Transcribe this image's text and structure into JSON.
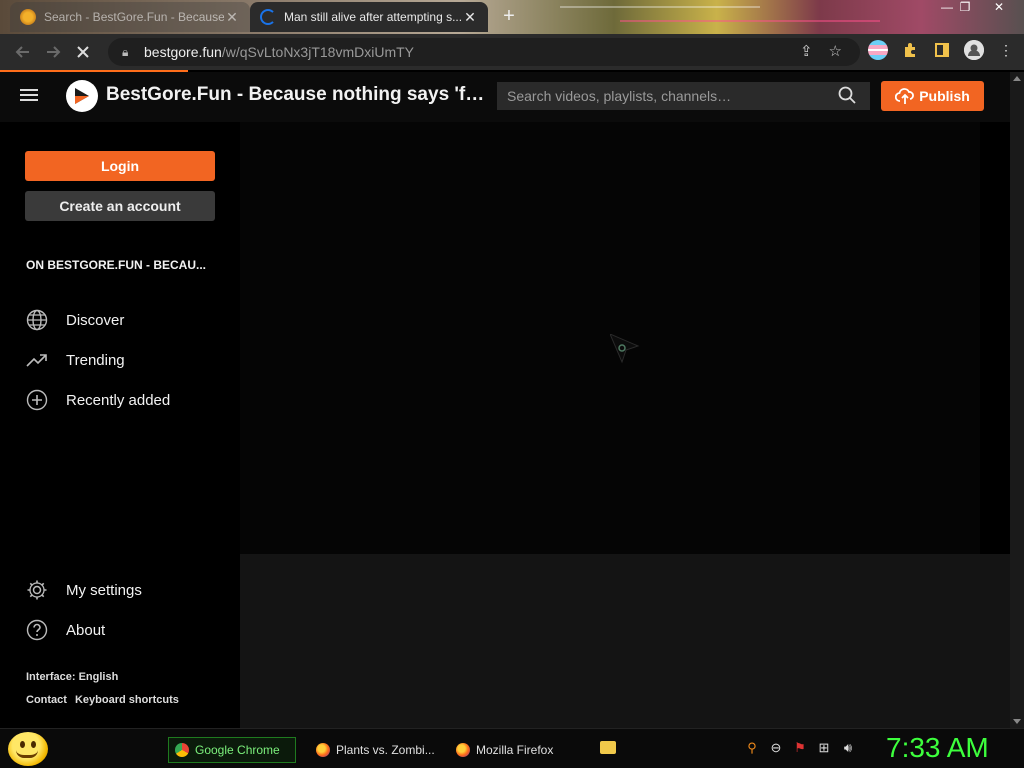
{
  "browser": {
    "tabs": [
      {
        "title": "Search - BestGore.Fun - Because...",
        "active": false
      },
      {
        "title": "Man still alive after attempting s...",
        "active": true
      }
    ],
    "new_tab_label": "+",
    "window_controls": {
      "minimize": "—",
      "maximize": "❐",
      "close": "✕"
    },
    "url_host": "bestgore.fun",
    "url_path": "/w/qSvLtoNx3jT18vmDxiUmTY"
  },
  "site": {
    "title": "BestGore.Fun - Because nothing says 'fu...",
    "search_placeholder": "Search videos, playlists, channels…",
    "publish_label": "Publish",
    "accent_color": "#f26522"
  },
  "sidebar": {
    "login_label": "Login",
    "create_account_label": "Create an account",
    "section_heading": "ON BESTGORE.FUN - BECAU...",
    "nav": [
      {
        "label": "Discover",
        "icon": "globe-icon"
      },
      {
        "label": "Trending",
        "icon": "trending-icon"
      },
      {
        "label": "Recently added",
        "icon": "plus-circle-icon"
      }
    ],
    "bottom_nav": [
      {
        "label": "My settings",
        "icon": "gear-icon"
      },
      {
        "label": "About",
        "icon": "help-icon"
      }
    ],
    "interface_language": "Interface: English",
    "footer_links": [
      "Contact",
      "Keyboard shortcuts"
    ]
  },
  "taskbar": {
    "items": [
      {
        "label": "Google Chrome",
        "active": true
      },
      {
        "label": "Plants vs. Zombi...",
        "active": false
      },
      {
        "label": "Mozilla Firefox",
        "active": false
      }
    ],
    "clock": "7:33 AM",
    "clock_color": "#3dff3d"
  }
}
